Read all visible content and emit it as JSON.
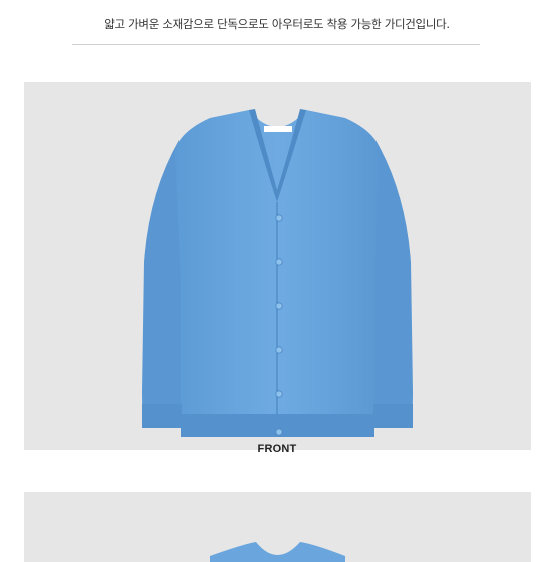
{
  "product": {
    "description": "얇고 가벼운 소재감으로 단독으로도 아우터로도 착용 가능한 가디건입니다.",
    "front_caption": "FRONT",
    "garment_color": "#6aa6dd",
    "background_color": "#e6e6e6"
  }
}
